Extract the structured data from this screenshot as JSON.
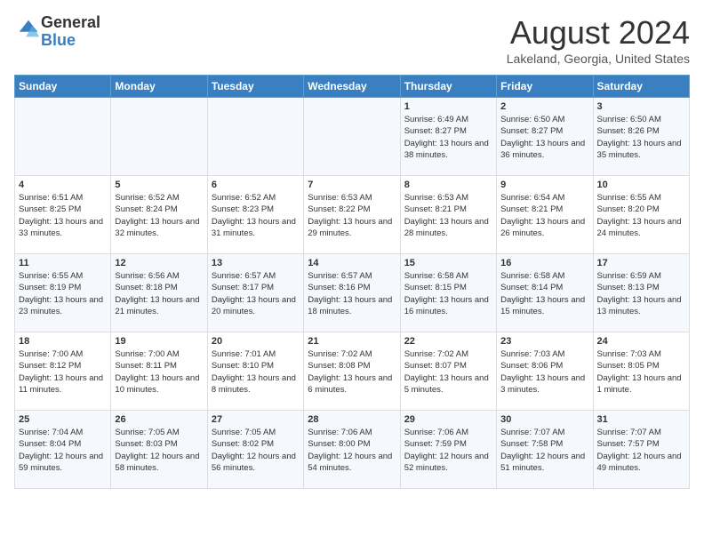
{
  "logo": {
    "general": "General",
    "blue": "Blue"
  },
  "title": "August 2024",
  "location": "Lakeland, Georgia, United States",
  "days_of_week": [
    "Sunday",
    "Monday",
    "Tuesday",
    "Wednesday",
    "Thursday",
    "Friday",
    "Saturday"
  ],
  "weeks": [
    [
      {
        "day": "",
        "sunrise": "",
        "sunset": "",
        "daylight": ""
      },
      {
        "day": "",
        "sunrise": "",
        "sunset": "",
        "daylight": ""
      },
      {
        "day": "",
        "sunrise": "",
        "sunset": "",
        "daylight": ""
      },
      {
        "day": "",
        "sunrise": "",
        "sunset": "",
        "daylight": ""
      },
      {
        "day": "1",
        "sunrise": "Sunrise: 6:49 AM",
        "sunset": "Sunset: 8:27 PM",
        "daylight": "Daylight: 13 hours and 38 minutes."
      },
      {
        "day": "2",
        "sunrise": "Sunrise: 6:50 AM",
        "sunset": "Sunset: 8:27 PM",
        "daylight": "Daylight: 13 hours and 36 minutes."
      },
      {
        "day": "3",
        "sunrise": "Sunrise: 6:50 AM",
        "sunset": "Sunset: 8:26 PM",
        "daylight": "Daylight: 13 hours and 35 minutes."
      }
    ],
    [
      {
        "day": "4",
        "sunrise": "Sunrise: 6:51 AM",
        "sunset": "Sunset: 8:25 PM",
        "daylight": "Daylight: 13 hours and 33 minutes."
      },
      {
        "day": "5",
        "sunrise": "Sunrise: 6:52 AM",
        "sunset": "Sunset: 8:24 PM",
        "daylight": "Daylight: 13 hours and 32 minutes."
      },
      {
        "day": "6",
        "sunrise": "Sunrise: 6:52 AM",
        "sunset": "Sunset: 8:23 PM",
        "daylight": "Daylight: 13 hours and 31 minutes."
      },
      {
        "day": "7",
        "sunrise": "Sunrise: 6:53 AM",
        "sunset": "Sunset: 8:22 PM",
        "daylight": "Daylight: 13 hours and 29 minutes."
      },
      {
        "day": "8",
        "sunrise": "Sunrise: 6:53 AM",
        "sunset": "Sunset: 8:21 PM",
        "daylight": "Daylight: 13 hours and 28 minutes."
      },
      {
        "day": "9",
        "sunrise": "Sunrise: 6:54 AM",
        "sunset": "Sunset: 8:21 PM",
        "daylight": "Daylight: 13 hours and 26 minutes."
      },
      {
        "day": "10",
        "sunrise": "Sunrise: 6:55 AM",
        "sunset": "Sunset: 8:20 PM",
        "daylight": "Daylight: 13 hours and 24 minutes."
      }
    ],
    [
      {
        "day": "11",
        "sunrise": "Sunrise: 6:55 AM",
        "sunset": "Sunset: 8:19 PM",
        "daylight": "Daylight: 13 hours and 23 minutes."
      },
      {
        "day": "12",
        "sunrise": "Sunrise: 6:56 AM",
        "sunset": "Sunset: 8:18 PM",
        "daylight": "Daylight: 13 hours and 21 minutes."
      },
      {
        "day": "13",
        "sunrise": "Sunrise: 6:57 AM",
        "sunset": "Sunset: 8:17 PM",
        "daylight": "Daylight: 13 hours and 20 minutes."
      },
      {
        "day": "14",
        "sunrise": "Sunrise: 6:57 AM",
        "sunset": "Sunset: 8:16 PM",
        "daylight": "Daylight: 13 hours and 18 minutes."
      },
      {
        "day": "15",
        "sunrise": "Sunrise: 6:58 AM",
        "sunset": "Sunset: 8:15 PM",
        "daylight": "Daylight: 13 hours and 16 minutes."
      },
      {
        "day": "16",
        "sunrise": "Sunrise: 6:58 AM",
        "sunset": "Sunset: 8:14 PM",
        "daylight": "Daylight: 13 hours and 15 minutes."
      },
      {
        "day": "17",
        "sunrise": "Sunrise: 6:59 AM",
        "sunset": "Sunset: 8:13 PM",
        "daylight": "Daylight: 13 hours and 13 minutes."
      }
    ],
    [
      {
        "day": "18",
        "sunrise": "Sunrise: 7:00 AM",
        "sunset": "Sunset: 8:12 PM",
        "daylight": "Daylight: 13 hours and 11 minutes."
      },
      {
        "day": "19",
        "sunrise": "Sunrise: 7:00 AM",
        "sunset": "Sunset: 8:11 PM",
        "daylight": "Daylight: 13 hours and 10 minutes."
      },
      {
        "day": "20",
        "sunrise": "Sunrise: 7:01 AM",
        "sunset": "Sunset: 8:10 PM",
        "daylight": "Daylight: 13 hours and 8 minutes."
      },
      {
        "day": "21",
        "sunrise": "Sunrise: 7:02 AM",
        "sunset": "Sunset: 8:08 PM",
        "daylight": "Daylight: 13 hours and 6 minutes."
      },
      {
        "day": "22",
        "sunrise": "Sunrise: 7:02 AM",
        "sunset": "Sunset: 8:07 PM",
        "daylight": "Daylight: 13 hours and 5 minutes."
      },
      {
        "day": "23",
        "sunrise": "Sunrise: 7:03 AM",
        "sunset": "Sunset: 8:06 PM",
        "daylight": "Daylight: 13 hours and 3 minutes."
      },
      {
        "day": "24",
        "sunrise": "Sunrise: 7:03 AM",
        "sunset": "Sunset: 8:05 PM",
        "daylight": "Daylight: 13 hours and 1 minute."
      }
    ],
    [
      {
        "day": "25",
        "sunrise": "Sunrise: 7:04 AM",
        "sunset": "Sunset: 8:04 PM",
        "daylight": "Daylight: 12 hours and 59 minutes."
      },
      {
        "day": "26",
        "sunrise": "Sunrise: 7:05 AM",
        "sunset": "Sunset: 8:03 PM",
        "daylight": "Daylight: 12 hours and 58 minutes."
      },
      {
        "day": "27",
        "sunrise": "Sunrise: 7:05 AM",
        "sunset": "Sunset: 8:02 PM",
        "daylight": "Daylight: 12 hours and 56 minutes."
      },
      {
        "day": "28",
        "sunrise": "Sunrise: 7:06 AM",
        "sunset": "Sunset: 8:00 PM",
        "daylight": "Daylight: 12 hours and 54 minutes."
      },
      {
        "day": "29",
        "sunrise": "Sunrise: 7:06 AM",
        "sunset": "Sunset: 7:59 PM",
        "daylight": "Daylight: 12 hours and 52 minutes."
      },
      {
        "day": "30",
        "sunrise": "Sunrise: 7:07 AM",
        "sunset": "Sunset: 7:58 PM",
        "daylight": "Daylight: 12 hours and 51 minutes."
      },
      {
        "day": "31",
        "sunrise": "Sunrise: 7:07 AM",
        "sunset": "Sunset: 7:57 PM",
        "daylight": "Daylight: 12 hours and 49 minutes."
      }
    ]
  ]
}
